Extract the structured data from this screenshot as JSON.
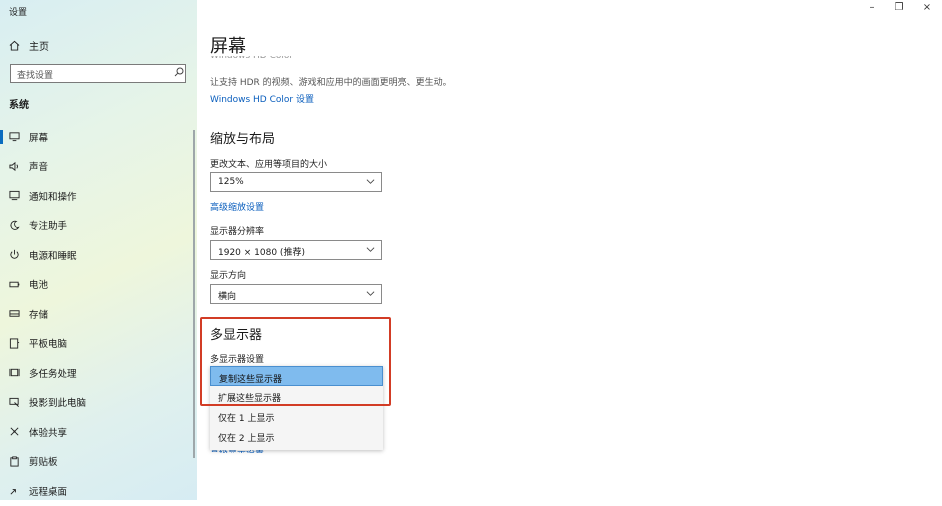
{
  "window": {
    "title": "设置",
    "minimize": "–",
    "maximize": "❐",
    "close": "×"
  },
  "sidebar": {
    "home_label": "主页",
    "search_placeholder": "查找设置",
    "section_title": "系统",
    "items": [
      {
        "label": "屏幕",
        "icon": "monitor-icon",
        "active": true
      },
      {
        "label": "声音",
        "icon": "speaker-icon"
      },
      {
        "label": "通知和操作",
        "icon": "notification-icon"
      },
      {
        "label": "专注助手",
        "icon": "moon-icon"
      },
      {
        "label": "电源和睡眠",
        "icon": "power-icon"
      },
      {
        "label": "电池",
        "icon": "battery-icon"
      },
      {
        "label": "存储",
        "icon": "storage-icon"
      },
      {
        "label": "平板电脑",
        "icon": "tablet-icon"
      },
      {
        "label": "多任务处理",
        "icon": "multitask-icon"
      },
      {
        "label": "投影到此电脑",
        "icon": "project-icon"
      },
      {
        "label": "体验共享",
        "icon": "share-icon"
      },
      {
        "label": "剪贴板",
        "icon": "clipboard-icon"
      },
      {
        "label": "远程桌面",
        "icon": "remote-icon"
      }
    ]
  },
  "main": {
    "page_title": "屏幕",
    "cut_heading": "Windows HD Color",
    "hdr_description": "让支持 HDR 的视频、游戏和应用中的画面更明亮、更生动。",
    "hdr_link": "Windows HD Color 设置",
    "scale_section": "缩放与布局",
    "scale_label": "更改文本、应用等项目的大小",
    "scale_value": "125%",
    "advanced_scale_link": "高级缩放设置",
    "resolution_label": "显示器分辨率",
    "resolution_value": "1920 × 1080 (推荐)",
    "orientation_label": "显示方向",
    "orientation_value": "横向",
    "multi_section": "多显示器",
    "multi_label": "多显示器设置",
    "multi_options": [
      "复制这些显示器",
      "扩展这些显示器",
      "仅在 1 上显示",
      "仅在 2 上显示"
    ],
    "cut_link": "高级显示设置"
  },
  "colors": {
    "accent": "#0a6cbf",
    "highlight_border": "#d23c25",
    "selected_option": "#7fbbee"
  }
}
